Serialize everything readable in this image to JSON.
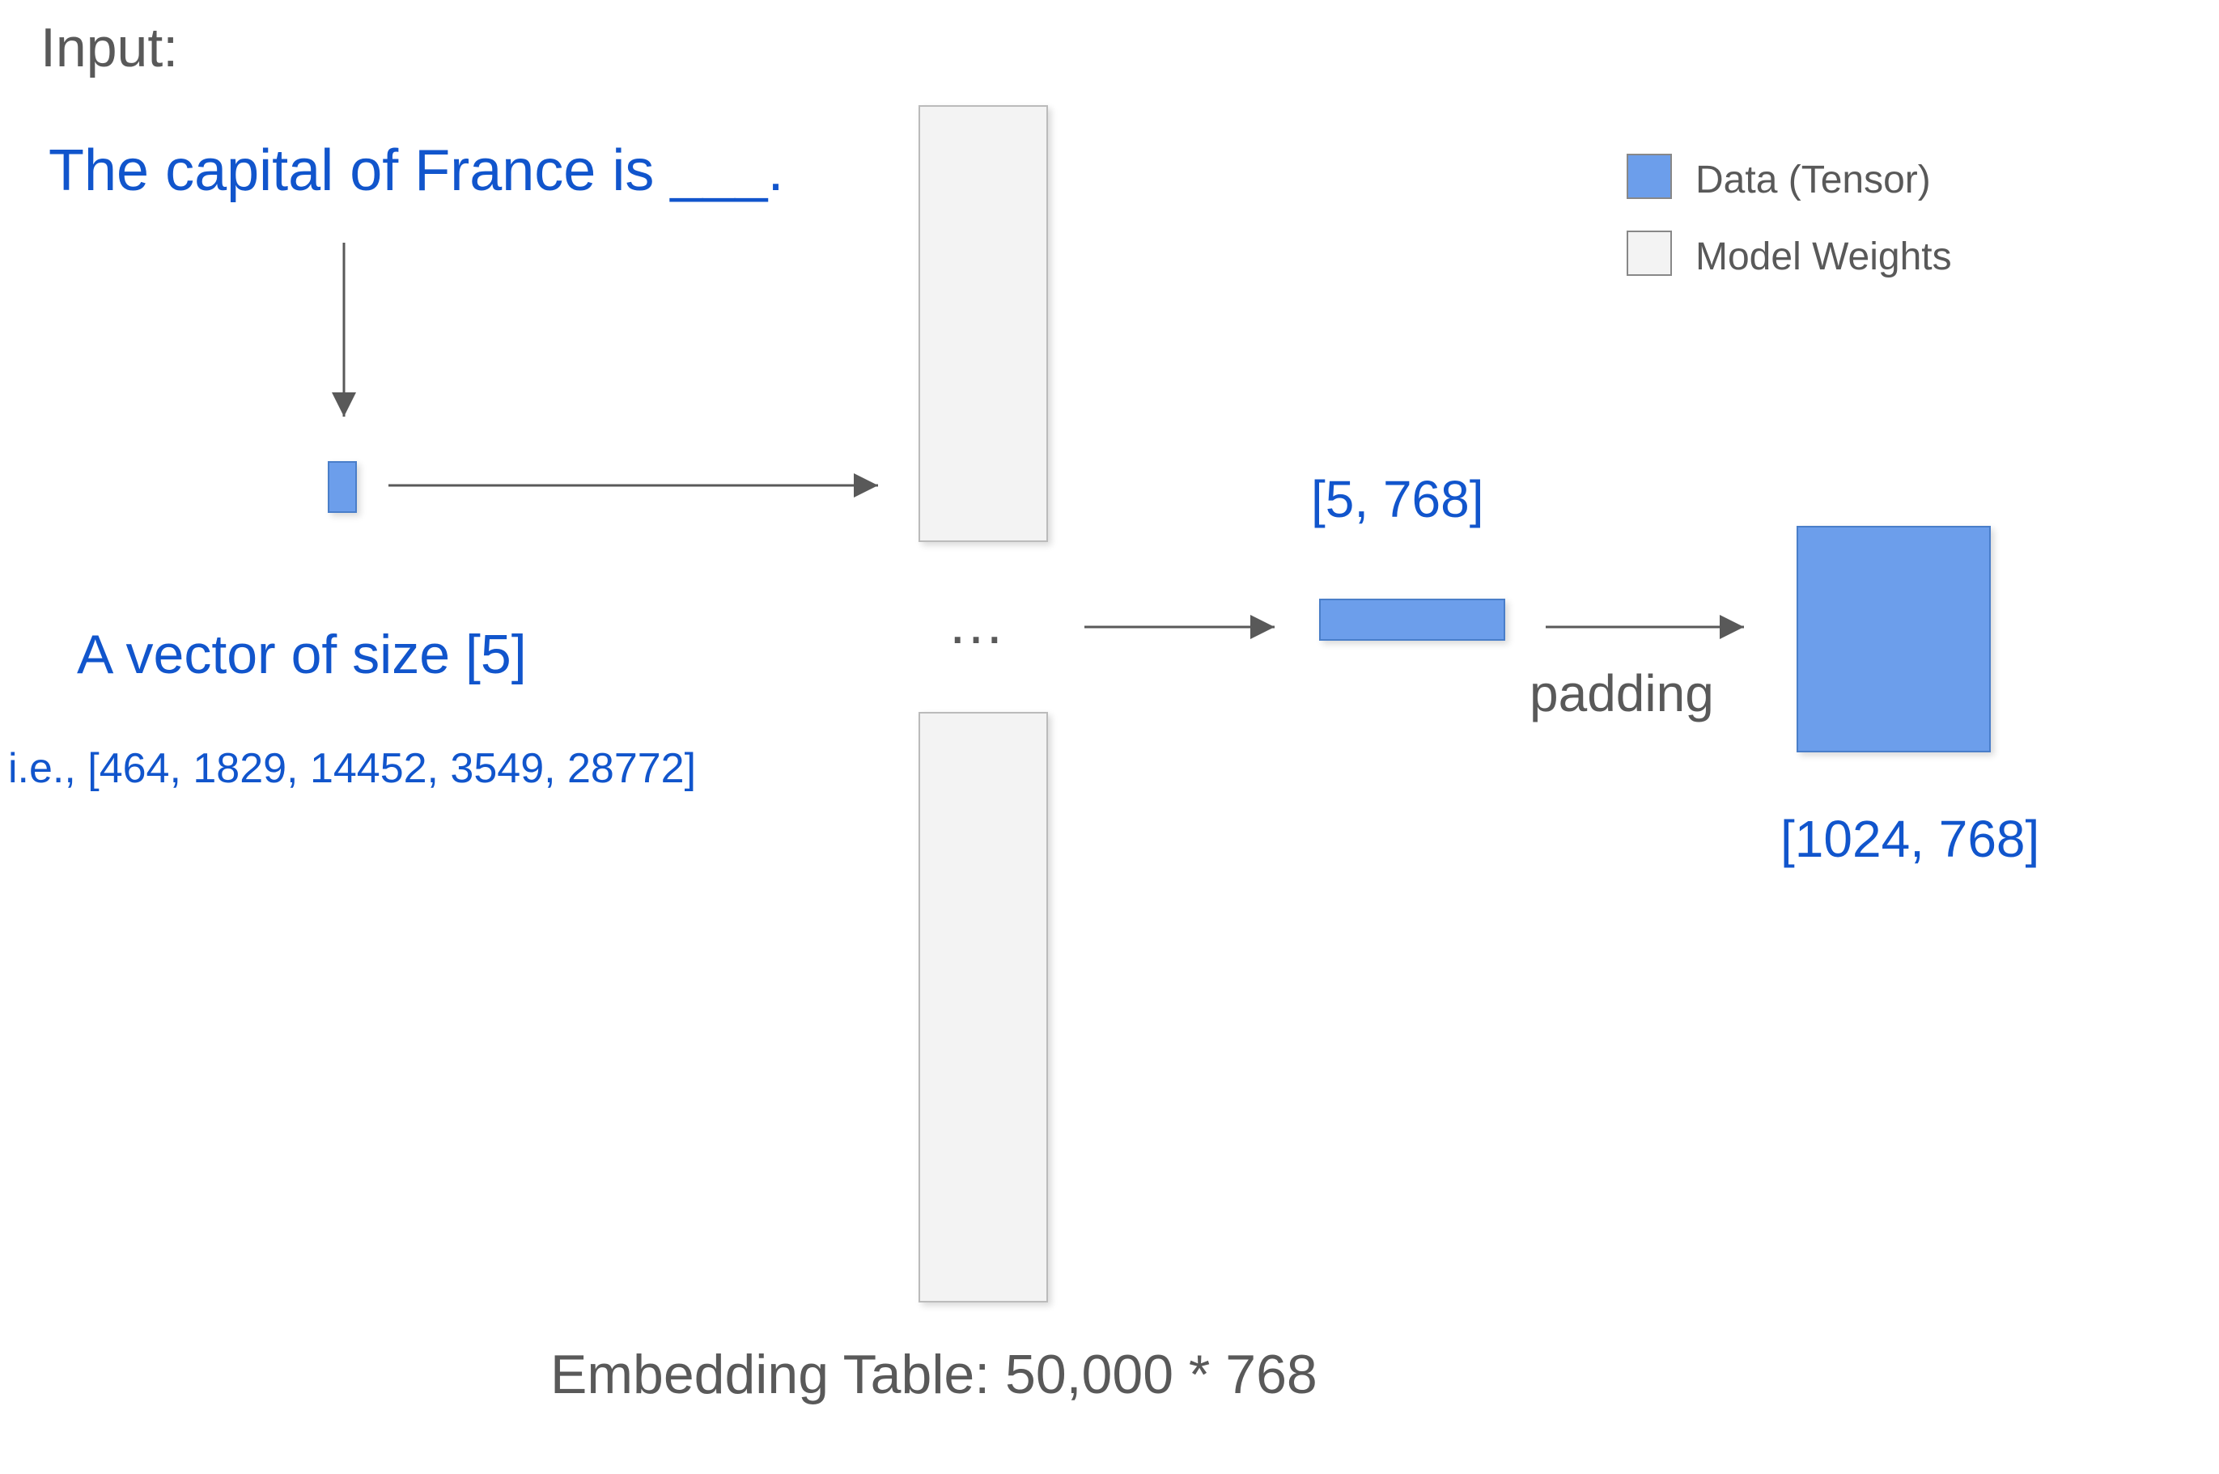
{
  "header": {
    "label": "Input:"
  },
  "input_sentence": "The capital of France is ___.",
  "vector_label": "A vector of size [5]",
  "vector_example": "i.e., [464, 1829, 14452, 3549, 28772]",
  "ellipsis": "…",
  "tensor1_label": "[5, 768]",
  "padding_label": "padding",
  "tensor2_label": "[1024, 768]",
  "embedding_label": "Embedding Table: 50,000 * 768",
  "legend": {
    "data": "Data (Tensor)",
    "weights": "Model Weights"
  }
}
